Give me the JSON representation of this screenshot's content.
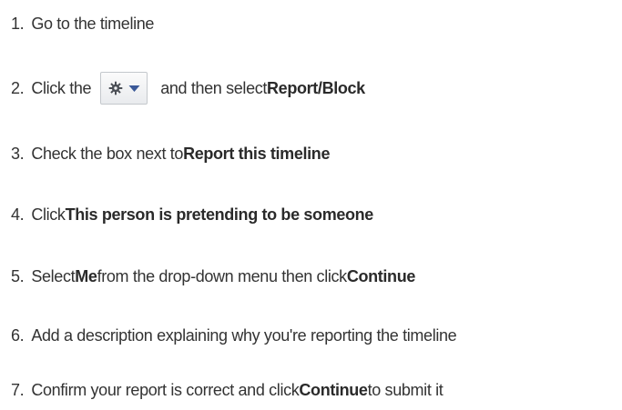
{
  "steps": [
    {
      "number": "1.",
      "parts": [
        {
          "text": "Go to the timeline",
          "bold": false
        }
      ]
    },
    {
      "number": "2.",
      "parts": [
        {
          "text": "Click the",
          "bold": false
        },
        {
          "icon": "gear-dropdown-button"
        },
        {
          "text": "and then select ",
          "bold": false
        },
        {
          "text": "Report/Block",
          "bold": true
        }
      ]
    },
    {
      "number": "3.",
      "parts": [
        {
          "text": "Check the box next to ",
          "bold": false
        },
        {
          "text": "Report this timeline",
          "bold": true
        }
      ]
    },
    {
      "number": "4.",
      "parts": [
        {
          "text": "Click ",
          "bold": false
        },
        {
          "text": "This person is pretending to be someone",
          "bold": true
        }
      ]
    },
    {
      "number": "5.",
      "parts": [
        {
          "text": "Select ",
          "bold": false
        },
        {
          "text": "Me",
          "bold": true
        },
        {
          "text": " from the drop-down menu then click ",
          "bold": false
        },
        {
          "text": "Continue",
          "bold": true
        }
      ]
    },
    {
      "number": "6.",
      "parts": [
        {
          "text": "Add a description explaining why you're reporting the timeline",
          "bold": false
        }
      ]
    },
    {
      "number": "7.",
      "parts": [
        {
          "text": "Confirm your report is correct and click ",
          "bold": false
        },
        {
          "text": "Continue",
          "bold": true
        },
        {
          "text": " to submit it",
          "bold": false
        }
      ]
    }
  ],
  "icons": {
    "gear": "gear-icon",
    "chevron": "chevron-down-icon",
    "gear_color": "#4b4f56",
    "chevron_color": "#3b5998"
  }
}
